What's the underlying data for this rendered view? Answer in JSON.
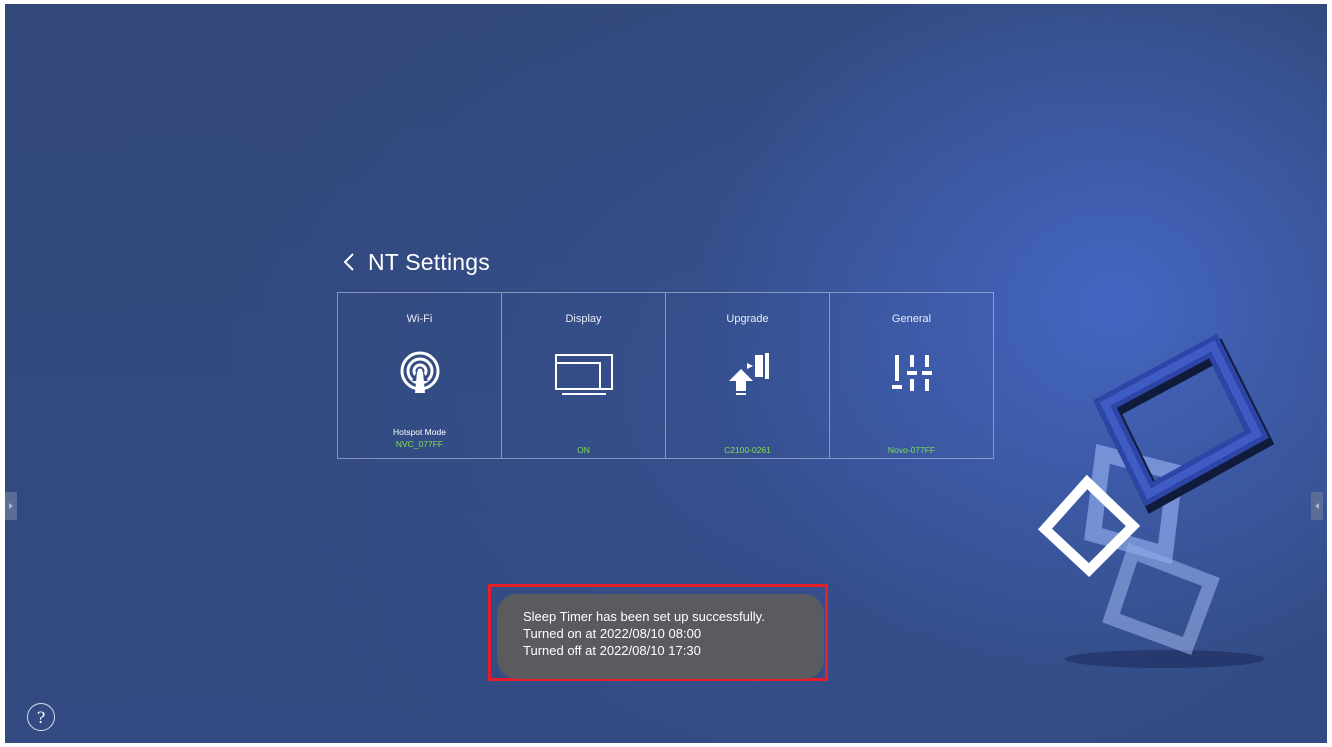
{
  "header": {
    "title": "NT Settings",
    "back_icon": "chevron-left-icon"
  },
  "tiles": [
    {
      "label": "Wi-Fi",
      "icon": "hotspot-antenna-icon",
      "sub": "Hotspot Mode",
      "status": "NVC_077FF"
    },
    {
      "label": "Display",
      "icon": "display-monitor-icon",
      "sub": "",
      "status": "ON"
    },
    {
      "label": "Upgrade",
      "icon": "upgrade-arrow-icon",
      "sub": "",
      "status": "C2100-0261"
    },
    {
      "label": "General",
      "icon": "sliders-icon",
      "sub": "",
      "status": "Novo-077FF"
    }
  ],
  "toast": {
    "line1": "Sleep Timer has been set up successfully.",
    "line2": "Turned on at 2022/08/10 08:00",
    "line3": "Turned off at 2022/08/10 17:30"
  },
  "help": {
    "label": "?"
  },
  "colors": {
    "background": "#334b82",
    "status_green": "#7ee04e",
    "highlight_red": "#e3202a",
    "toast_bg": "#5c5c5c"
  }
}
